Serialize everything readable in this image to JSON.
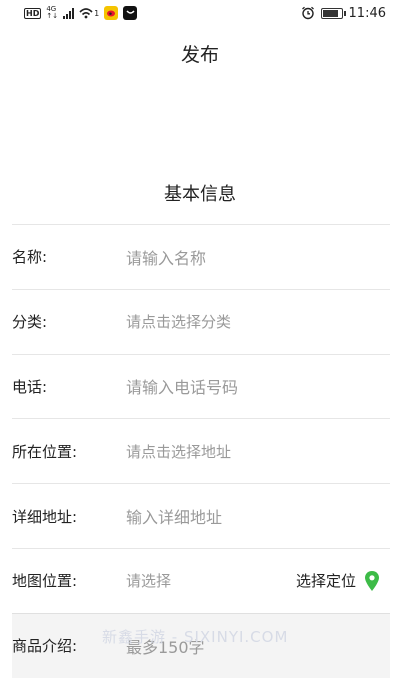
{
  "status": {
    "hd": "HD",
    "net_top": "4G",
    "net_bottom": "↑↓",
    "notif_count": "1",
    "time": "11:46"
  },
  "header": {
    "title": "发布"
  },
  "section": {
    "title": "基本信息"
  },
  "form": {
    "name_label": "名称:",
    "name_placeholder": "请输入名称",
    "category_label": "分类:",
    "category_placeholder": "请点击选择分类",
    "phone_label": "电话:",
    "phone_placeholder": "请输入电话号码",
    "location_label": "所在位置:",
    "location_placeholder": "请点击选择地址",
    "address_label": "详细地址:",
    "address_placeholder": "输入详细地址",
    "map_label": "地图位置:",
    "map_placeholder": "请选择",
    "map_action": "选择定位",
    "intro_label": "商品介绍:",
    "intro_placeholder": "最多150字"
  },
  "watermark": "新鑫手游 - SIXINYI.COM",
  "colors": {
    "pin": "#3dbb47",
    "placeholder": "#9a9a9a",
    "divider": "#e6e6e6"
  }
}
